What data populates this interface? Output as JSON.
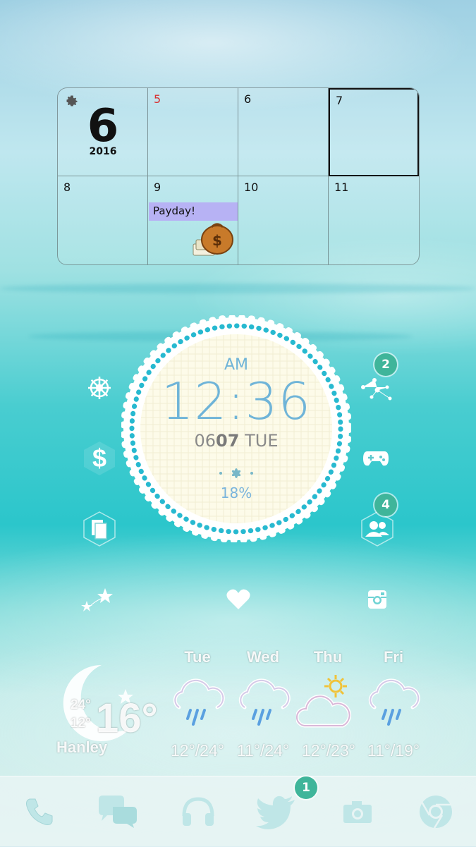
{
  "calendar": {
    "month_number": "6",
    "year": "2016",
    "days": [
      "5",
      "6",
      "7",
      "8",
      "9",
      "10",
      "11"
    ],
    "event_title": "Payday!"
  },
  "clock": {
    "ampm": "AM",
    "time": "12:36",
    "date_month": "06",
    "date_day": "07",
    "weekday": "TUE",
    "battery": "18%"
  },
  "badges": {
    "constellation": "2",
    "contacts": "4",
    "twitter": "1"
  },
  "weather": {
    "location": "Hanley",
    "current_temp": "16°",
    "high": "24°",
    "low": "12°",
    "forecast": [
      {
        "day": "Tue",
        "range": "12°/24°",
        "icon": "rain-cloud-icon"
      },
      {
        "day": "Wed",
        "range": "11°/24°",
        "icon": "rain-cloud-icon"
      },
      {
        "day": "Thu",
        "range": "12°/23°",
        "icon": "sun-cloud-icon"
      },
      {
        "day": "Fri",
        "range": "11°/19°",
        "icon": "rain-cloud-icon"
      }
    ]
  },
  "colors": {
    "accent_blue": "#6fb4d8",
    "badge_green": "#3fb59a",
    "event_purple": "#b7b2f4"
  }
}
